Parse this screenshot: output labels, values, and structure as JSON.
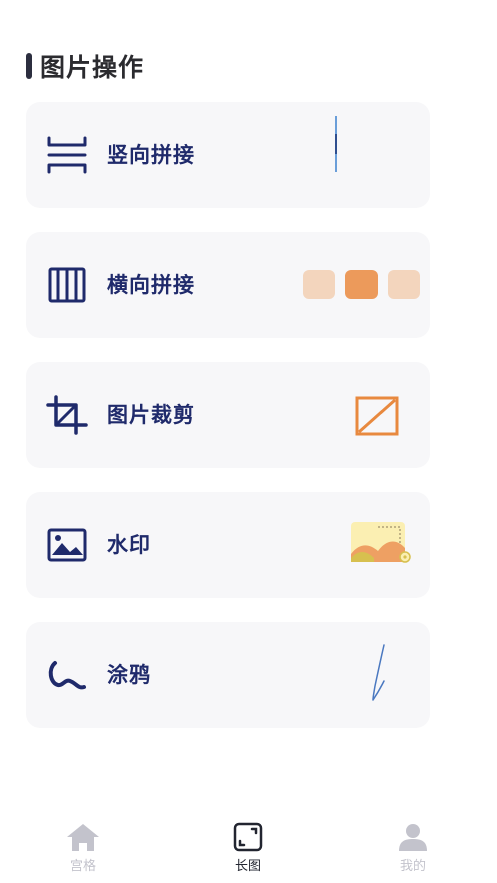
{
  "section": {
    "title": "图片操作"
  },
  "tools": [
    {
      "label": "竖向拼接",
      "icon": "vertical-stitch-icon"
    },
    {
      "label": "横向拼接",
      "icon": "horizontal-stitch-icon"
    },
    {
      "label": "图片裁剪",
      "icon": "crop-icon"
    },
    {
      "label": "水印",
      "icon": "watermark-icon"
    },
    {
      "label": "涂鸦",
      "icon": "doodle-icon"
    }
  ],
  "colors": {
    "accent": "#1f2a6b",
    "card_bg": "#f7f7f9",
    "orange": "#e8893f",
    "orange_light": "#f3d5bd",
    "tab_inactive": "#c3c3cc"
  },
  "tabbar": {
    "tabs": [
      {
        "label": "宫格",
        "icon": "home-icon",
        "active": false
      },
      {
        "label": "长图",
        "icon": "long-image-icon",
        "active": true
      },
      {
        "label": "我的",
        "icon": "user-icon",
        "active": false
      }
    ]
  }
}
